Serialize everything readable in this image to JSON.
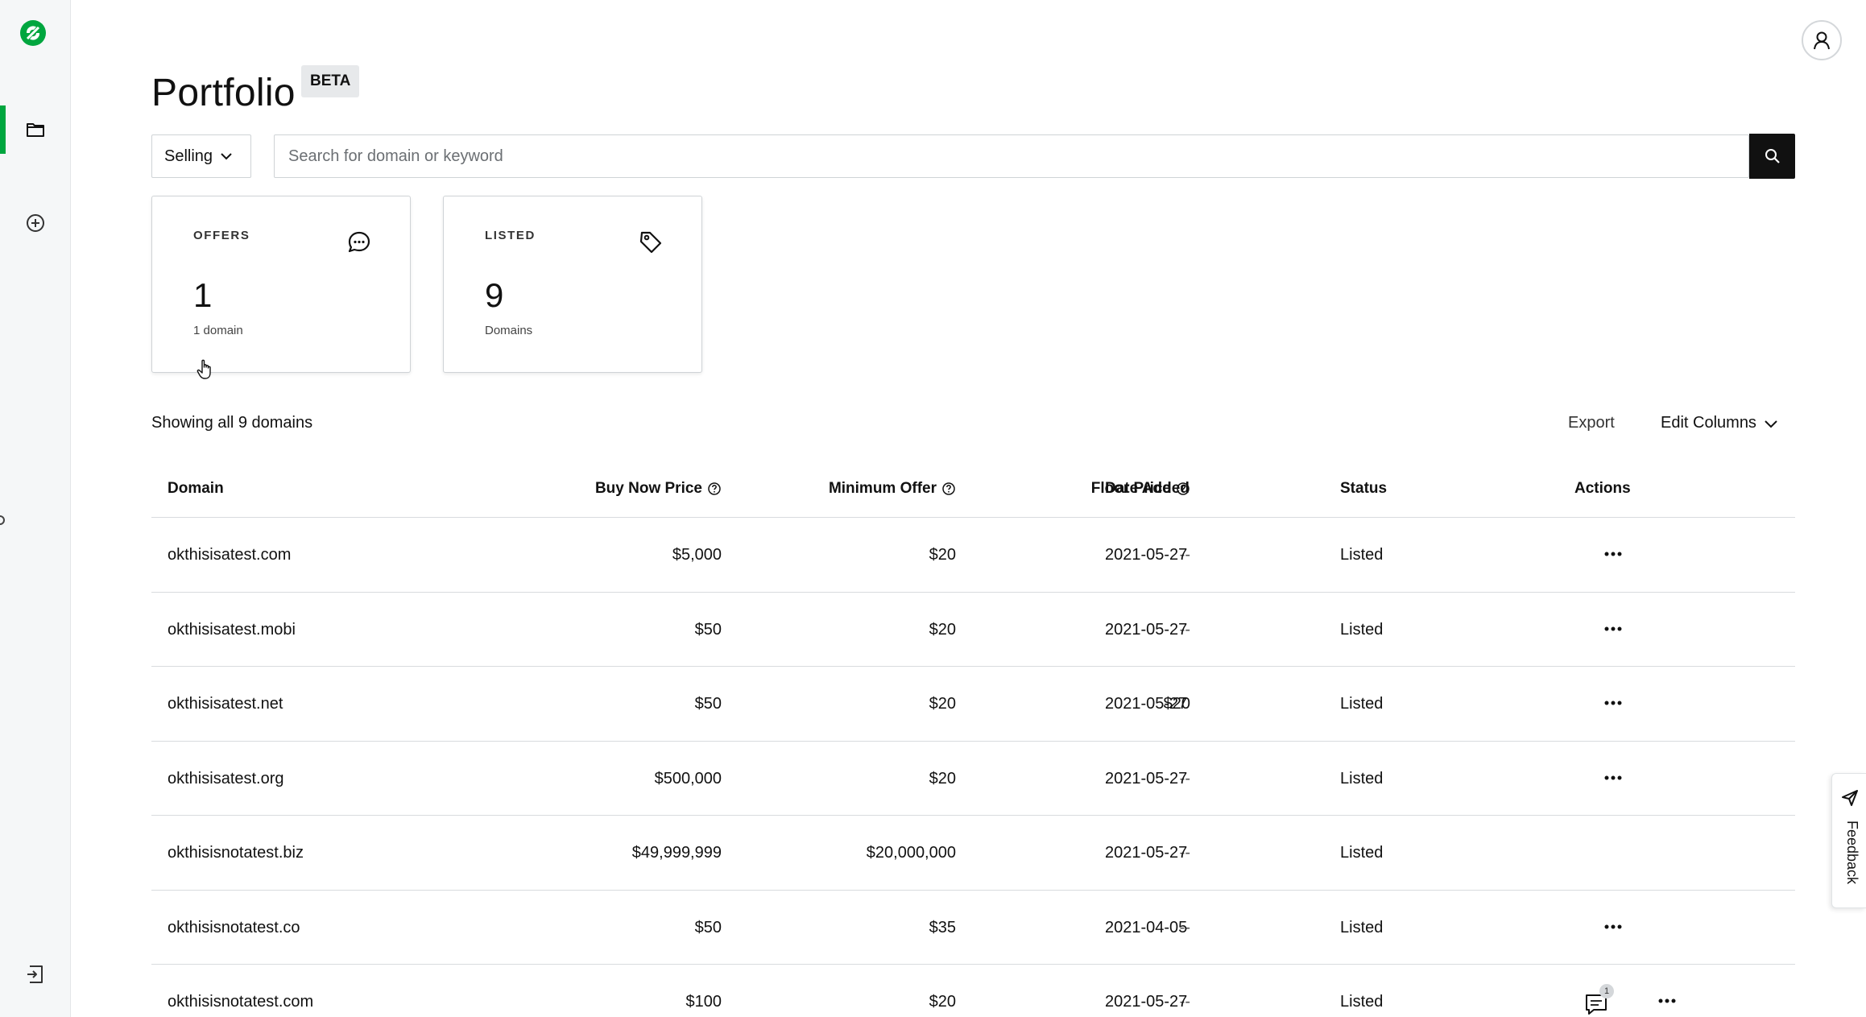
{
  "app": {
    "brand_color": "#00a63f"
  },
  "sidebar": {
    "items": [
      {
        "name": "portfolio",
        "icon": "folder-icon",
        "active": true
      },
      {
        "name": "add",
        "icon": "plus-circle-icon",
        "active": false
      },
      {
        "name": "exit",
        "icon": "exit-icon",
        "active": false
      }
    ]
  },
  "header": {
    "title": "Portfolio",
    "badge": "BETA"
  },
  "filters": {
    "mode": "Selling",
    "search_placeholder": "Search for domain or keyword"
  },
  "cards": {
    "offers": {
      "label": "OFFERS",
      "value": "1",
      "sub": "1 domain",
      "icon": "chat-icon"
    },
    "listed": {
      "label": "LISTED",
      "value": "9",
      "sub": "Domains",
      "icon": "tag-icon"
    }
  },
  "toolbar": {
    "showing": "Showing all 9 domains",
    "export": "Export",
    "edit_columns": "Edit Columns"
  },
  "table": {
    "headers": {
      "domain": "Domain",
      "buy_now": "Buy Now Price",
      "min_offer": "Minimum Offer",
      "floor": "Floor Price",
      "date_added": "Date Added",
      "status": "Status",
      "actions": "Actions"
    },
    "rows": [
      {
        "domain": "okthisisatest.com",
        "buy_now": "$5,000",
        "min_offer": "$20",
        "floor": "--",
        "date": "2021-05-27",
        "status": "Listed"
      },
      {
        "domain": "okthisisatest.mobi",
        "buy_now": "$50",
        "min_offer": "$20",
        "floor": "--",
        "date": "2021-05-27",
        "status": "Listed"
      },
      {
        "domain": "okthisisatest.net",
        "buy_now": "$50",
        "min_offer": "$20",
        "floor": "$20",
        "date": "2021-05-27",
        "status": "Listed"
      },
      {
        "domain": "okthisisatest.org",
        "buy_now": "$500,000",
        "min_offer": "$20",
        "floor": "--",
        "date": "2021-05-27",
        "status": "Listed"
      },
      {
        "domain": "okthisisnotatest.biz",
        "buy_now": "$49,999,999",
        "min_offer": "$20,000,000",
        "floor": "--",
        "date": "2021-05-27",
        "status": "Listed"
      },
      {
        "domain": "okthisisnotatest.co",
        "buy_now": "$50",
        "min_offer": "$35",
        "floor": "--",
        "date": "2021-04-05",
        "status": "Listed"
      },
      {
        "domain": "okthisisnotatest.com",
        "buy_now": "$100",
        "min_offer": "$20",
        "floor": "--",
        "date": "2021-05-27",
        "status": "Listed",
        "offers_badge": "1"
      }
    ]
  },
  "feedback": {
    "label": "Feedback"
  }
}
